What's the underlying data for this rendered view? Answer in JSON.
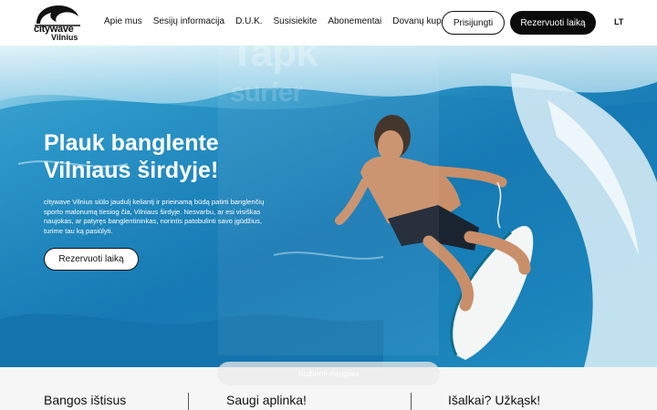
{
  "brand": {
    "name": "citywave",
    "city": "Vilnius"
  },
  "nav": {
    "items": [
      {
        "label": "Apie mus"
      },
      {
        "label": "Sesijų informacija"
      },
      {
        "label": "D.U.K."
      },
      {
        "label": "Susisiekite"
      },
      {
        "label": "Abonementai"
      },
      {
        "label": "Dovanų kuponai"
      }
    ]
  },
  "header": {
    "login_label": "Prisijungti",
    "book_label": "Rezervuoti laiką",
    "language": "LT"
  },
  "hero": {
    "title_line1": "Plauk banglente",
    "title_line2": "Vilniaus širdyje!",
    "text": "citywave Vilnius siūlo jaudulį keliantį ir prieinamą būdą patirti banglenčių sporto malonumą tiesiog čia, Vilniaus širdyje. Nesvarbu, ar esi visiškas naujokas, ar patyręs banglentininkas, norintis patobulinti savo įgūdžius, turime tau ką pasiūlyti.",
    "button_label": "Rezervuoti laiką"
  },
  "overlay": {
    "heading": "Tapk",
    "heading2": "surfer",
    "button_label": "Sužinoti daugiau"
  },
  "features": [
    {
      "label": "Bangos ištisus"
    },
    {
      "label": "Saugi aplinka!"
    },
    {
      "label": "Išalkai? Užkąsk!"
    }
  ],
  "colors": {
    "accent_dark": "#0b0b0b",
    "water_blue": "#1a78b1",
    "white": "#ffffff"
  }
}
